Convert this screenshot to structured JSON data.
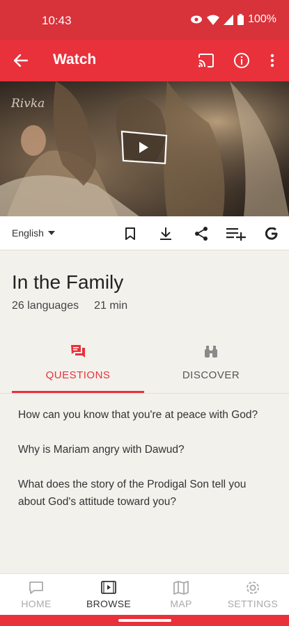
{
  "status_bar": {
    "time": "10:43",
    "battery": "100%"
  },
  "app_bar": {
    "title": "Watch",
    "icons": [
      "back-arrow-icon",
      "cast-icon",
      "info-icon",
      "more-vert-icon"
    ]
  },
  "video": {
    "caption": "Rivka",
    "play_icon": "play-icon"
  },
  "toolbar": {
    "language": "English",
    "icons": [
      "bookmark-icon",
      "download-icon",
      "share-icon",
      "playlist-add-icon",
      "gospel-logo-icon"
    ]
  },
  "film": {
    "title": "In the Family",
    "languages": "26 languages",
    "duration": "21 min"
  },
  "tabs": [
    {
      "label": "QUESTIONS",
      "icon": "questions-icon",
      "active": true
    },
    {
      "label": "DISCOVER",
      "icon": "binoculars-icon",
      "active": false
    }
  ],
  "questions": [
    "How can you know that you're at peace with God?",
    "Why is Mariam angry with Dawud?",
    "What does the story of the Prodigal Son tell you about God's attitude toward you?"
  ],
  "bottom_nav": [
    {
      "label": "HOME",
      "icon": "home-icon",
      "active": false
    },
    {
      "label": "BROWSE",
      "icon": "browse-icon",
      "active": true
    },
    {
      "label": "MAP",
      "icon": "map-icon",
      "active": false
    },
    {
      "label": "SETTINGS",
      "icon": "settings-icon",
      "active": false
    }
  ],
  "colors": {
    "accent": "#e8313b",
    "status_bar": "#d8323a",
    "background": "#f3f1ec"
  }
}
